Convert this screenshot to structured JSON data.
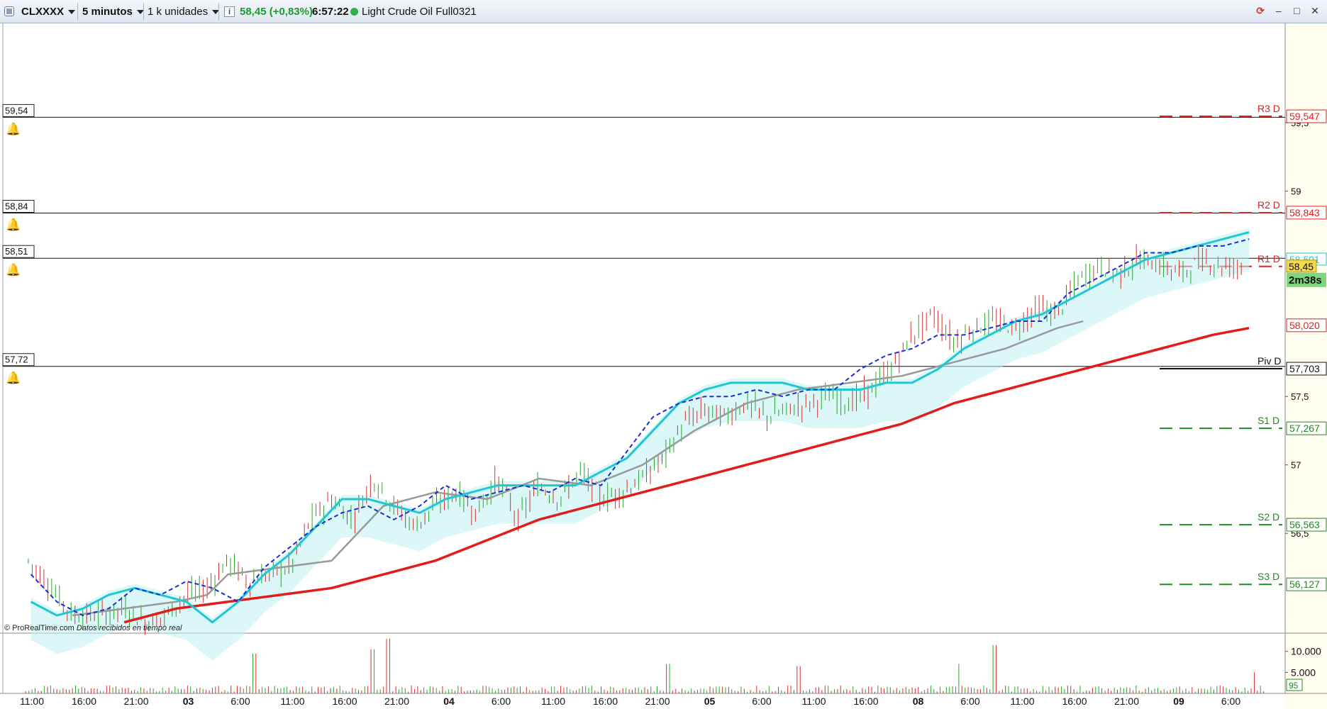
{
  "toolbar": {
    "symbol": "CLXXXX",
    "timeframe": "5 minutos",
    "units": "1 k unidades",
    "last_price_change": "58,45 (+0,83%)",
    "time": "6:57:22",
    "instrument_name": "Light Crude Oil Full0321",
    "price_change_color": "#1a9c2e"
  },
  "footer": {
    "credit": "© ProRealTime.com",
    "status": "Datos recibidos en tiempo real"
  },
  "price_tag": {
    "price": "58,45",
    "countdown": "2m38s",
    "indicator_value": "58,501"
  },
  "colors": {
    "price_axis_bg": "#fffdf0",
    "resistance": "#e02020",
    "support": "#1f8a1f",
    "pivot": "#111111",
    "ma_fast": "#1fc7d0",
    "ma_signal": "#1a2fd0",
    "ma_slow": "#e31b1b",
    "ma_grey": "#999999",
    "cloud": "#bff0f0",
    "cloud_neg": "#f7b5b5",
    "candle_up": "#2aa52a",
    "candle_down": "#d33030",
    "countdown_bg": "#7ed77e",
    "price_tag_bg": "#f7d84a"
  },
  "chart_data": {
    "type": "line",
    "title": "",
    "ylim": [
      56.0,
      60.0
    ],
    "y_ticks": [
      {
        "value": 59.5,
        "label": "59,5"
      },
      {
        "value": 59.0,
        "label": "59"
      },
      {
        "value": 57.5,
        "label": "57,5"
      },
      {
        "value": 57.0,
        "label": "57"
      },
      {
        "value": 56.5,
        "label": "56,5"
      }
    ],
    "x_ticks": [
      "11:00",
      "16:00",
      "21:00",
      "03",
      "6:00",
      "11:00",
      "16:00",
      "21:00",
      "04",
      "6:00",
      "11:00",
      "16:00",
      "21:00",
      "05",
      "6:00",
      "11:00",
      "16:00",
      "08",
      "6:00",
      "11:00",
      "16:00",
      "21:00",
      "09",
      "6:00"
    ],
    "x_ticks_bold": [
      false,
      false,
      false,
      true,
      false,
      false,
      false,
      false,
      true,
      false,
      false,
      false,
      false,
      true,
      false,
      false,
      false,
      true,
      false,
      false,
      false,
      false,
      true,
      false
    ],
    "alert_lines": [
      {
        "value": 59.54,
        "label": "59,54"
      },
      {
        "value": 58.84,
        "label": "58,84"
      },
      {
        "value": 58.51,
        "label": "58,51"
      },
      {
        "value": 57.72,
        "label": "57,72"
      }
    ],
    "pivot_levels": [
      {
        "name": "R3 D",
        "value": 59.547,
        "label": "59,547",
        "kind": "resistance"
      },
      {
        "name": "R2 D",
        "value": 58.843,
        "label": "58,843",
        "kind": "resistance"
      },
      {
        "name": "R1 D",
        "value": 58.45,
        "label": "",
        "kind": "resistance"
      },
      {
        "name": "",
        "value": 58.02,
        "label": "58,020",
        "kind": "resistance"
      },
      {
        "name": "Piv D",
        "value": 57.703,
        "label": "57,703",
        "kind": "pivot"
      },
      {
        "name": "S1 D",
        "value": 57.267,
        "label": "57,267",
        "kind": "support"
      },
      {
        "name": "S2 D",
        "value": 56.563,
        "label": "56,563",
        "kind": "support"
      },
      {
        "name": "S3 D",
        "value": 56.127,
        "label": "56,127",
        "kind": "support"
      }
    ],
    "series": [
      {
        "key": "close",
        "x": [
          0.15,
          0.5,
          1.0,
          1.5,
          2.0,
          2.4,
          2.8,
          3.2,
          3.6,
          4.0,
          4.4,
          4.8,
          5.2,
          5.6,
          6.0,
          6.4,
          6.8,
          7.2,
          7.6,
          8.0,
          8.4,
          8.8,
          9.2,
          9.6,
          10.0,
          10.4,
          10.8,
          11.2,
          11.6,
          12.0,
          12.4,
          12.8,
          13.2,
          13.6,
          14.0,
          14.4,
          14.8,
          15.2,
          15.6,
          16.0,
          16.4,
          16.8,
          17.2,
          17.6,
          18.0,
          18.4,
          18.8,
          19.2,
          19.6,
          20.0,
          20.4,
          20.8,
          21.2,
          21.6,
          22.0,
          22.4,
          22.8,
          23.2,
          23.6
        ],
        "values": [
          56.3,
          56.15,
          55.9,
          55.9,
          55.95,
          55.85,
          55.9,
          56.05,
          56.1,
          56.3,
          56.15,
          56.2,
          56.25,
          56.6,
          56.75,
          56.6,
          56.9,
          56.7,
          56.55,
          56.7,
          56.8,
          56.65,
          56.9,
          56.6,
          56.85,
          56.75,
          56.95,
          56.75,
          56.8,
          56.9,
          57.05,
          57.3,
          57.4,
          57.35,
          57.45,
          57.35,
          57.4,
          57.45,
          57.5,
          57.45,
          57.55,
          57.7,
          57.95,
          58.1,
          57.9,
          58.0,
          58.05,
          58.0,
          58.15,
          58.1,
          58.35,
          58.45,
          58.4,
          58.5,
          58.45,
          58.4,
          58.5,
          58.45,
          58.45
        ]
      },
      {
        "key": "ma_fast",
        "x": [
          0.2,
          0.7,
          1.2,
          1.7,
          2.2,
          2.7,
          3.2,
          3.7,
          4.2,
          4.7,
          5.2,
          5.7,
          6.2,
          6.7,
          7.2,
          7.7,
          8.2,
          8.7,
          9.2,
          9.7,
          10.2,
          10.7,
          11.2,
          11.7,
          12.2,
          12.7,
          13.2,
          13.7,
          14.2,
          14.7,
          15.2,
          15.7,
          16.2,
          16.7,
          17.2,
          17.7,
          18.2,
          18.7,
          19.2,
          19.7,
          20.2,
          20.7,
          21.2,
          21.7,
          22.2,
          22.7,
          23.2,
          23.7
        ],
        "values": [
          56.0,
          55.9,
          55.95,
          56.05,
          56.1,
          56.05,
          56.0,
          55.85,
          56.0,
          56.2,
          56.35,
          56.55,
          56.75,
          56.75,
          56.7,
          56.65,
          56.75,
          56.8,
          56.85,
          56.85,
          56.85,
          56.85,
          56.95,
          57.05,
          57.25,
          57.45,
          57.55,
          57.6,
          57.6,
          57.6,
          57.55,
          57.55,
          57.55,
          57.6,
          57.6,
          57.7,
          57.85,
          57.95,
          58.05,
          58.1,
          58.2,
          58.3,
          58.4,
          58.5,
          58.55,
          58.6,
          58.65,
          58.7
        ]
      },
      {
        "key": "ma_signal",
        "x": [
          0.2,
          0.7,
          1.2,
          1.7,
          2.2,
          2.7,
          3.2,
          3.7,
          4.2,
          4.7,
          5.2,
          5.7,
          6.2,
          6.7,
          7.2,
          7.7,
          8.2,
          8.7,
          9.2,
          9.7,
          10.2,
          10.7,
          11.2,
          11.7,
          12.2,
          12.7,
          13.2,
          13.7,
          14.2,
          14.7,
          15.2,
          15.7,
          16.2,
          16.7,
          17.2,
          17.7,
          18.2,
          18.7,
          19.2,
          19.7,
          20.2,
          20.7,
          21.2,
          21.7,
          22.2,
          22.7,
          23.2,
          23.7
        ],
        "values": [
          56.2,
          56.0,
          55.9,
          55.95,
          56.1,
          56.05,
          56.15,
          56.1,
          56.0,
          56.25,
          56.4,
          56.55,
          56.65,
          56.7,
          56.6,
          56.7,
          56.85,
          56.75,
          56.8,
          56.85,
          56.8,
          56.9,
          56.85,
          57.1,
          57.35,
          57.45,
          57.5,
          57.5,
          57.55,
          57.5,
          57.55,
          57.55,
          57.7,
          57.8,
          57.85,
          57.95,
          57.95,
          58.0,
          58.05,
          58.05,
          58.25,
          58.35,
          58.45,
          58.55,
          58.55,
          58.6,
          58.6,
          58.65
        ]
      },
      {
        "key": "ma_slow",
        "x": [
          2.0,
          3.0,
          4.0,
          5.0,
          6.0,
          7.0,
          8.0,
          9.0,
          10.0,
          11.0,
          12.0,
          13.0,
          14.0,
          15.0,
          16.0,
          17.0,
          18.0,
          19.0,
          20.0,
          21.0,
          22.0,
          23.0,
          23.7
        ],
        "values": [
          55.85,
          55.95,
          56.0,
          56.05,
          56.1,
          56.2,
          56.3,
          56.45,
          56.6,
          56.7,
          56.8,
          56.9,
          57.0,
          57.1,
          57.2,
          57.3,
          57.45,
          57.55,
          57.65,
          57.75,
          57.85,
          57.95,
          58.0
        ]
      },
      {
        "key": "ma_grey",
        "x": [
          1.0,
          2.0,
          3.0,
          3.6,
          4.0,
          5.0,
          6.0,
          7.0,
          8.0,
          9.0,
          10.0,
          11.0,
          12.0,
          13.0,
          14.0,
          15.0,
          16.0,
          17.0,
          18.0,
          19.0,
          20.0,
          20.5
        ],
        "values": [
          55.9,
          55.95,
          56.0,
          56.05,
          56.2,
          56.25,
          56.3,
          56.7,
          56.8,
          56.75,
          56.9,
          56.85,
          57.0,
          57.25,
          57.45,
          57.55,
          57.6,
          57.65,
          57.75,
          57.85,
          58.0,
          58.05
        ]
      }
    ],
    "volume": {
      "y_ticks": [
        {
          "value": 10000,
          "label": "10.000"
        },
        {
          "value": 5000,
          "label": "5.000"
        }
      ],
      "last_label": "95",
      "spikes": [
        {
          "x": 4.5,
          "value": 9500
        },
        {
          "x": 6.8,
          "value": 10500
        },
        {
          "x": 7.1,
          "value": 13000
        },
        {
          "x": 12.5,
          "value": 7000
        },
        {
          "x": 15.0,
          "value": 6500
        },
        {
          "x": 18.1,
          "value": 7000
        },
        {
          "x": 18.8,
          "value": 11500
        },
        {
          "x": 23.8,
          "value": 5000
        }
      ]
    }
  }
}
